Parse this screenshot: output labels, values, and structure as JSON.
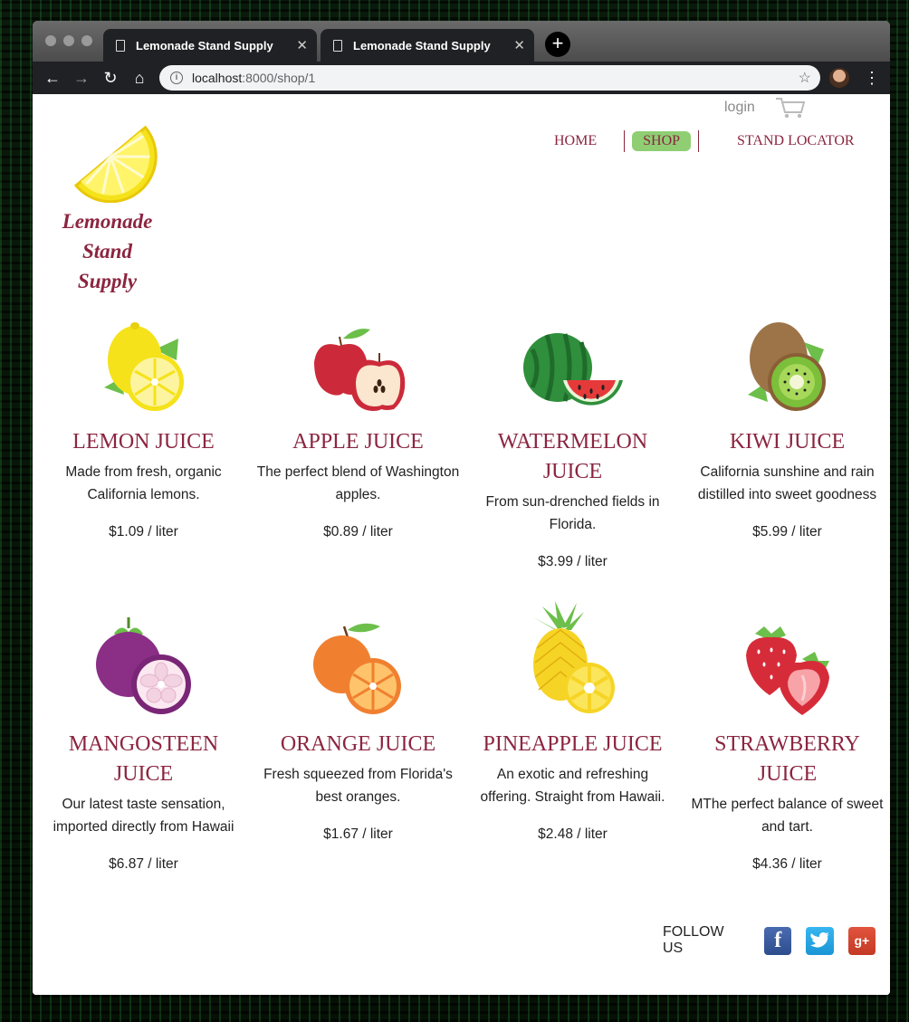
{
  "browser": {
    "tabs": [
      {
        "title": "Lemonade Stand Supply"
      },
      {
        "title": "Lemonade Stand Supply"
      }
    ],
    "url_host": "localhost",
    "url_path": ":8000/shop/1"
  },
  "header": {
    "brand_line1": "Lemonade",
    "brand_line2": "Stand",
    "brand_line3": "Supply",
    "login": "login",
    "nav": {
      "home": "HOME",
      "shop": "SHOP",
      "locator": "STAND LOCATOR"
    }
  },
  "products": [
    {
      "name": "LEMON JUICE",
      "description": "Made from fresh, organic California lemons.",
      "price": "$1.09 / liter",
      "icon": "lemon-icon"
    },
    {
      "name": "APPLE JUICE",
      "description": "The perfect blend of Washington apples.",
      "price": "$0.89 / liter",
      "icon": "apple-icon"
    },
    {
      "name": "WATERMELON JUICE",
      "description": "From sun-drenched fields in Florida.",
      "price": "$3.99 / liter",
      "icon": "watermelon-icon"
    },
    {
      "name": "KIWI JUICE",
      "description": "California sunshine and rain distilled into sweet goodness",
      "price": "$5.99 / liter",
      "icon": "kiwi-icon"
    },
    {
      "name": "MANGOSTEEN JUICE",
      "description": "Our latest taste sensation, imported directly from Hawaii",
      "price": "$6.87 / liter",
      "icon": "mangosteen-icon"
    },
    {
      "name": "ORANGE JUICE",
      "description": "Fresh squeezed from Florida's best oranges.",
      "price": "$1.67 / liter",
      "icon": "orange-icon"
    },
    {
      "name": "PINEAPPLE JUICE",
      "description": "An exotic and refreshing offering. Straight from Hawaii.",
      "price": "$2.48 / liter",
      "icon": "pineapple-icon"
    },
    {
      "name": "STRAWBERRY JUICE",
      "description": "MThe perfect balance of sweet and tart.",
      "price": "$4.36 / liter",
      "icon": "strawberry-icon"
    }
  ],
  "footer": {
    "follow_label": "FOLLOW US",
    "social": [
      "facebook-icon",
      "twitter-icon",
      "google-plus-icon"
    ]
  },
  "colors": {
    "accent": "#8b2540",
    "nav_active": "#8fce73"
  }
}
